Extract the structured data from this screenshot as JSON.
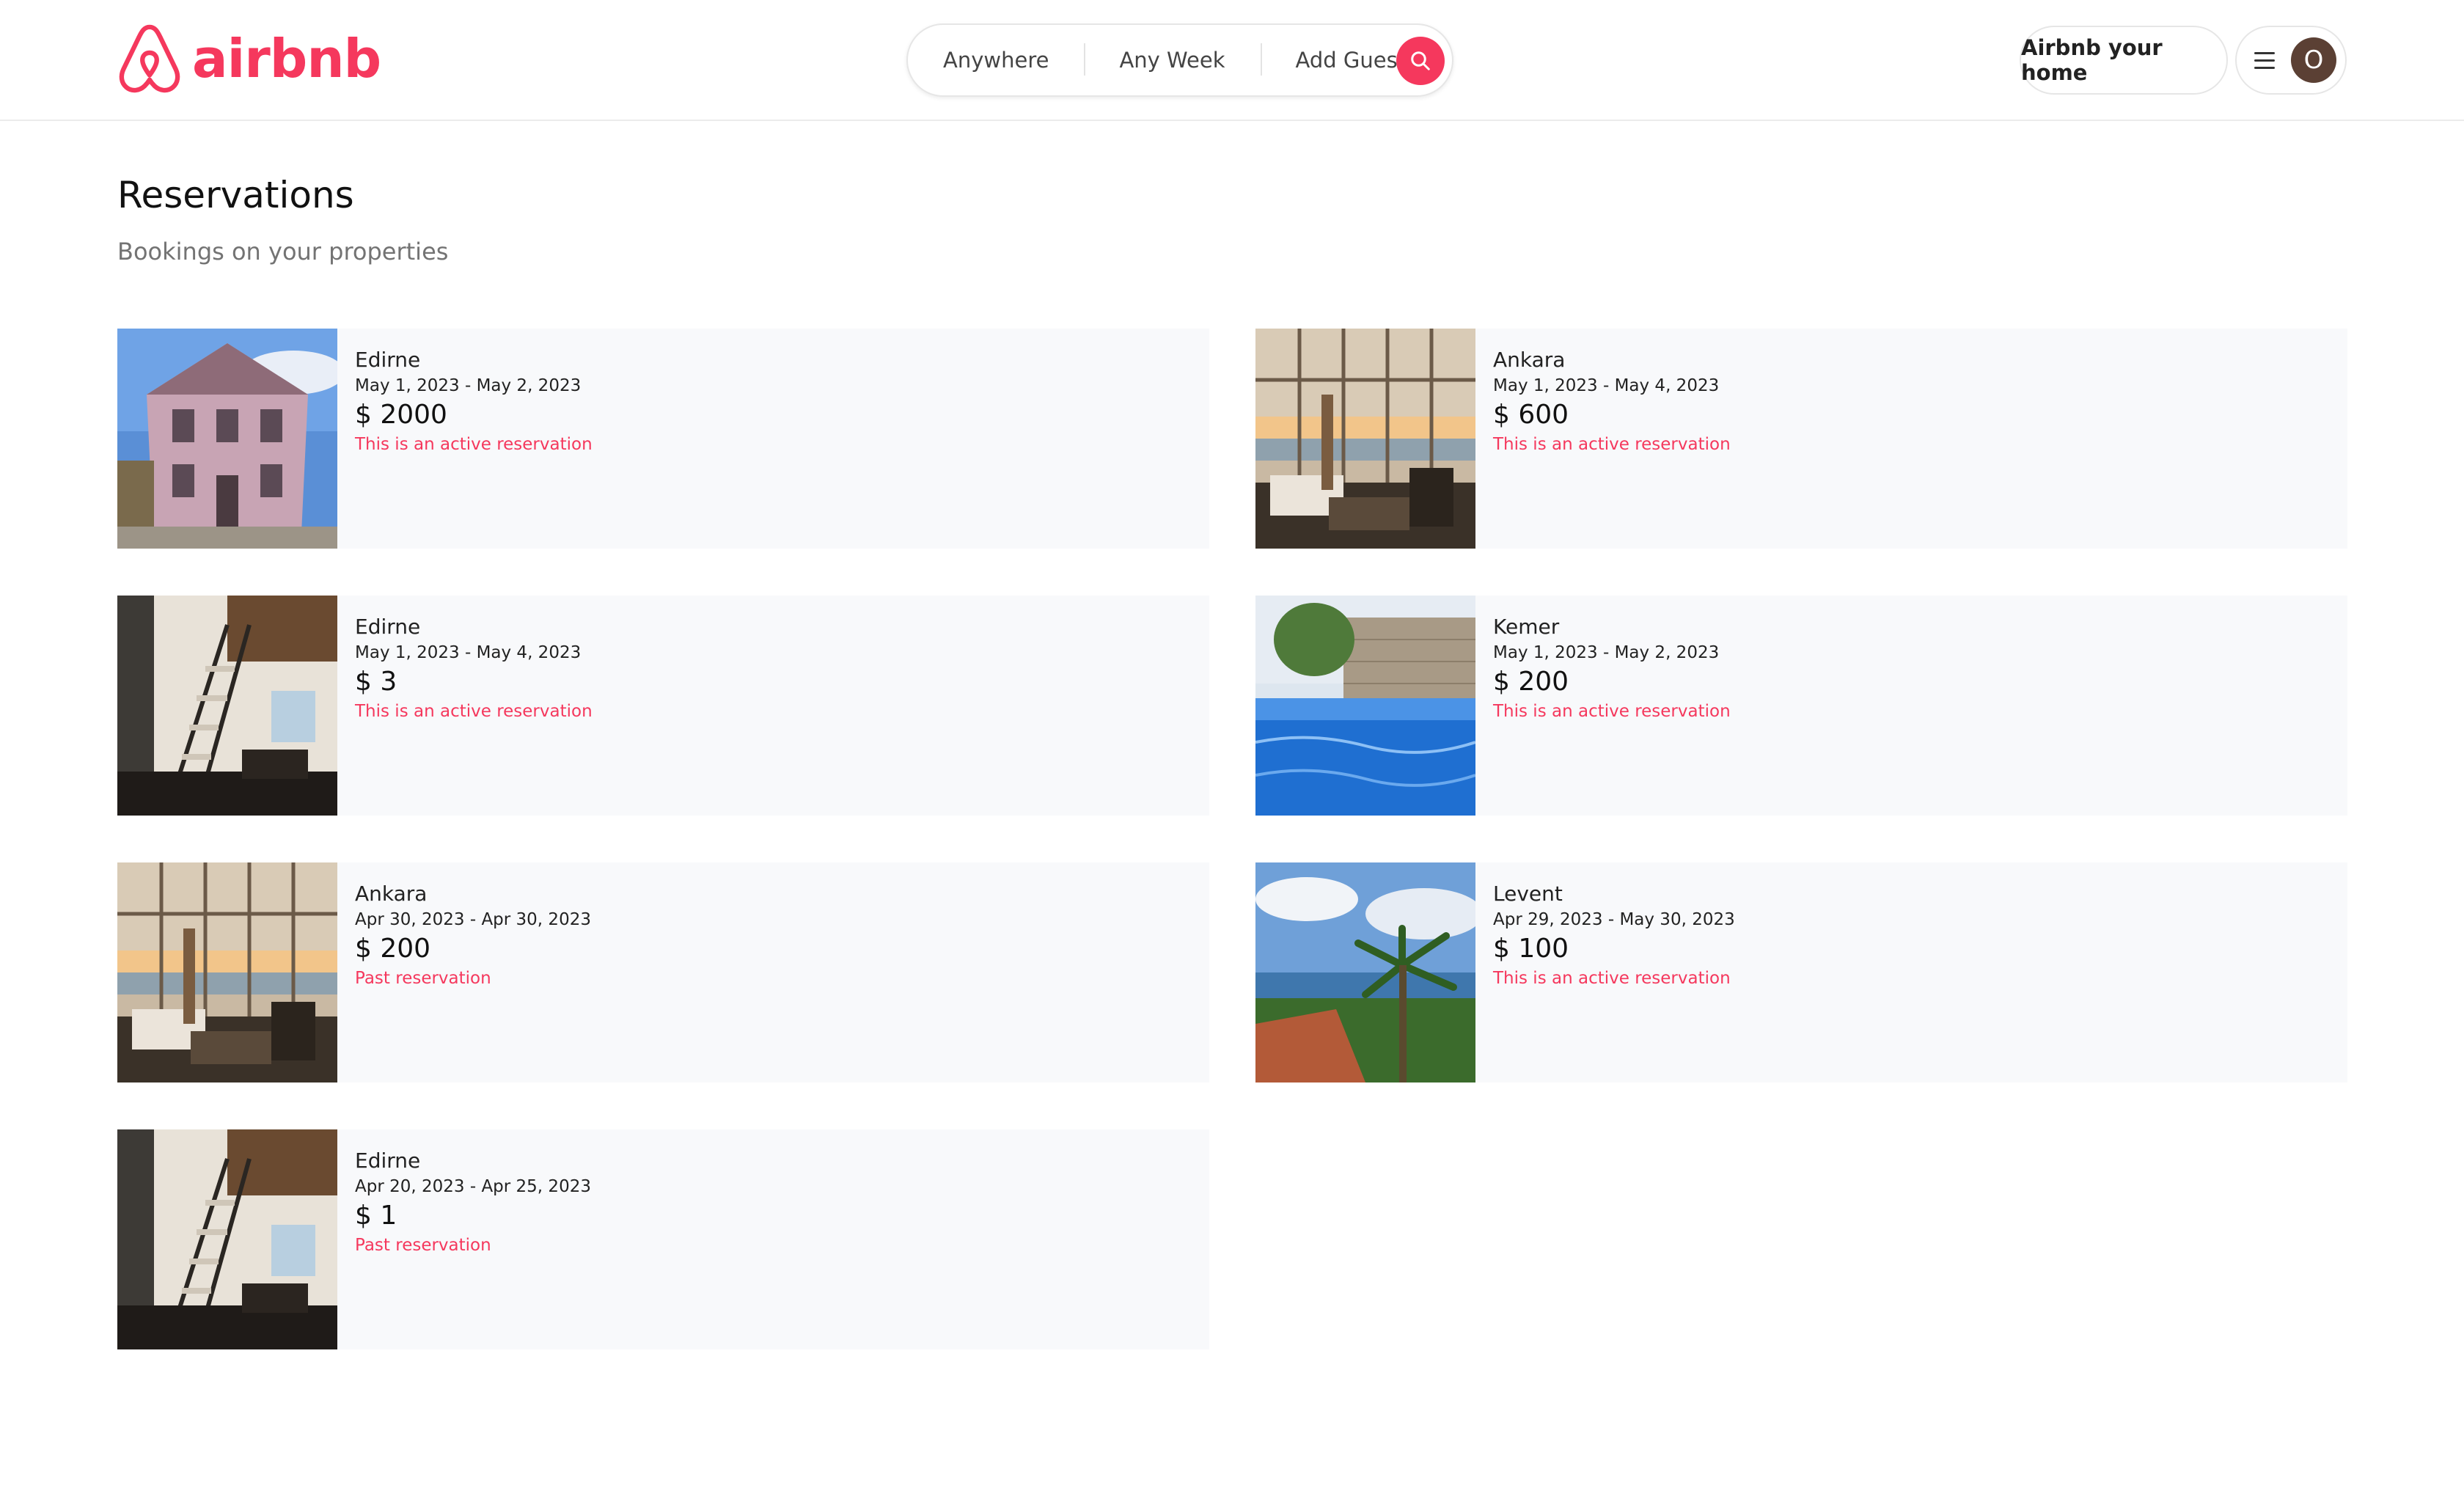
{
  "brand": {
    "name": "airbnb",
    "color": "#f5385d",
    "logo_icon": "airbnb-logo-icon"
  },
  "search": {
    "where": "Anywhere",
    "when": "Any Week",
    "guests": "Add Guests",
    "button_icon": "search-icon"
  },
  "header": {
    "host_label": "Airbnb your home",
    "menu_icon": "hamburger-menu-icon",
    "avatar_initial": "O"
  },
  "page": {
    "title": "Reservations",
    "subtitle": "Bookings on your properties"
  },
  "reservations": [
    {
      "location": "Edirne",
      "dates": "May 1, 2023 - May 2, 2023",
      "price": "$ 2000",
      "status": "This is an active reservation",
      "image": "pink-wooden-house-photo"
    },
    {
      "location": "Ankara",
      "dates": "May 1, 2023 - May 4, 2023",
      "price": "$ 600",
      "status": "This is an active reservation",
      "image": "living-room-sea-view-photo"
    },
    {
      "location": "Edirne",
      "dates": "May 1, 2023 - May 4, 2023",
      "price": "$ 3",
      "status": "This is an active reservation",
      "image": "loft-staircase-interior-photo"
    },
    {
      "location": "Kemer",
      "dates": "May 1, 2023 - May 2, 2023",
      "price": "$ 200",
      "status": "This is an active reservation",
      "image": "pool-stone-wall-photo"
    },
    {
      "location": "Ankara",
      "dates": "Apr 30, 2023 - Apr 30, 2023",
      "price": "$ 200",
      "status": "Past reservation",
      "image": "living-room-sea-view-photo"
    },
    {
      "location": "Levent",
      "dates": "Apr 29, 2023 - May 30, 2023",
      "price": "$ 100",
      "status": "This is an active reservation",
      "image": "palm-tree-sea-view-photo"
    },
    {
      "location": "Edirne",
      "dates": "Apr 20, 2023 - Apr 25, 2023",
      "price": "$ 1",
      "status": "Past reservation",
      "image": "loft-staircase-interior-photo"
    }
  ]
}
